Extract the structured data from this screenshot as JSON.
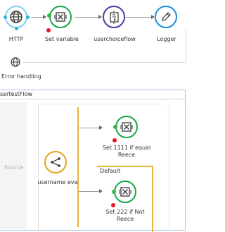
{
  "main_flow": {
    "http": {
      "label": "HTTP",
      "icon": "globe-icon",
      "color": "#1b9fd8"
    },
    "set_variable": {
      "label": "Set variable",
      "icon": "variable-x-icon",
      "color": "#1aa64d"
    },
    "userchoiceflow": {
      "label": "userchoiceflow",
      "icon": "flow-reference-icon",
      "color": "#4d3aa8"
    },
    "logger": {
      "label": "Logger",
      "icon": "pencil-icon",
      "color": "#1b8fd8"
    }
  },
  "error_handling": {
    "label": "Error handling",
    "icon": "globe-icon"
  },
  "subflow": {
    "title": "sertestFlow",
    "source_label": "Source",
    "choice": {
      "label": "username eval",
      "icon": "choice-router-icon",
      "color": "#e8a21a"
    },
    "when_set": {
      "label": "Set 1111 if equal Reece"
    },
    "default_label": "Default",
    "default_set": {
      "label": "Set 222 if Not Reece"
    }
  },
  "colors": {
    "green": "#1aa64d",
    "red": "#e8141e",
    "orange": "#e8a21a",
    "cyan": "#2fb0d8"
  }
}
